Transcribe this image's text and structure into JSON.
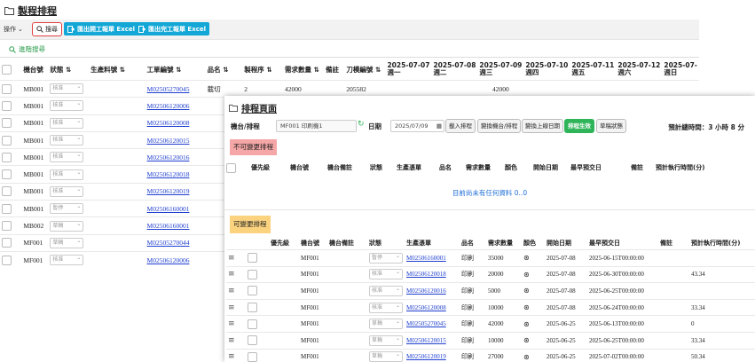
{
  "bg": {
    "title": "製程排程",
    "op_label": "操作",
    "search_label": "搜尋",
    "export1": "匯出開工報單 Excel",
    "export2": "匯出完工報單 Excel",
    "adv_search": "進階搜尋",
    "columns": {
      "machine": "機台號",
      "status": "狀態",
      "material": "生產料號",
      "order": "工單編號",
      "name": "品名",
      "seq": "製程序",
      "qty": "需求數量",
      "note": "備註",
      "blade": "刀模編號"
    },
    "dates": [
      {
        "date": "2025-07-07",
        "day": "週一"
      },
      {
        "date": "2025-07-08",
        "day": "週二"
      },
      {
        "date": "2025-07-09",
        "day": "週三"
      },
      {
        "date": "2025-07-10",
        "day": "週四"
      },
      {
        "date": "2025-07-11",
        "day": "週五"
      },
      {
        "date": "2025-07-12",
        "day": "週六"
      },
      {
        "date": "2025-07-",
        "day": "週日"
      }
    ],
    "rows": [
      {
        "machine": "MB001",
        "status": "核准",
        "order": "M02505270045",
        "name": "截切",
        "seq": "2",
        "qty": "42000",
        "blade": "205582",
        "d3": "42000"
      },
      {
        "machine": "MB001",
        "status": "核准",
        "order": "M02506120006"
      },
      {
        "machine": "MB001",
        "status": "核准",
        "order": "M02506120008"
      },
      {
        "machine": "MB001",
        "status": "核准",
        "order": "M02506120015"
      },
      {
        "machine": "MB001",
        "status": "核准",
        "order": "M02506120016"
      },
      {
        "machine": "MB001",
        "status": "核准",
        "order": "M02506120018"
      },
      {
        "machine": "MB001",
        "status": "核准",
        "order": "M02506120019"
      },
      {
        "machine": "MB001",
        "status": "暫停",
        "order": "M02506160001"
      },
      {
        "machine": "MB002",
        "status": "草稿",
        "order": "M02506160001"
      },
      {
        "machine": "MF001",
        "status": "草稿",
        "order": "M02505270044"
      },
      {
        "machine": "MF001",
        "status": "核准",
        "order": "M02506120006"
      }
    ]
  },
  "dlg": {
    "title": "排程頁面",
    "machine_label": "機台/排程",
    "machine_value": "MF001 印刷機1",
    "date_label": "日期",
    "date_value": "2025/07/09",
    "btn_import": "載入排程",
    "btn_switch": "變換機台/排程",
    "btn_online": "變換上線日期",
    "btn_generate": "排程生效",
    "btn_draft": "草稿狀態",
    "total": "預計總時間：3 小時 8 分",
    "locked_title": "不可變更排程",
    "unlocked_title": "可變更排程",
    "empty_msg": "目前尚未有任何資料 0..0",
    "cols_top": [
      "優先級",
      "機台號",
      "機台備註",
      "狀態",
      "生產憑單",
      "品名",
      "需求數量",
      "顏色",
      "開始日期",
      "最早預交日",
      "備註",
      "預計執行時間(分)"
    ],
    "cols_bottom": [
      "優先級",
      "機台號",
      "機台備註",
      "狀態",
      "生產憑單",
      "品名",
      "需求數量",
      "顏色",
      "開始日期",
      "最早預交日",
      "備註",
      "預計執行時間(分)"
    ],
    "rows": [
      {
        "machine": "MF001",
        "status": "暫停",
        "order": "M02506160001",
        "name": "印刷",
        "qty": "35000",
        "start": "2025-07-08",
        "due": "2025-06-15T00:00:00",
        "time": ""
      },
      {
        "machine": "MF001",
        "status": "核准",
        "order": "M02506120018",
        "name": "印刷",
        "qty": "20000",
        "start": "2025-07-08",
        "due": "2025-06-30T00:00:00",
        "time": "43.34"
      },
      {
        "machine": "MF001",
        "status": "核准",
        "order": "M02506120016",
        "name": "印刷",
        "qty": "5000",
        "start": "2025-07-08",
        "due": "2025-06-25T00:00:00",
        "time": ""
      },
      {
        "machine": "MF001",
        "status": "核准",
        "order": "M02506120008",
        "name": "印刷",
        "qty": "10000",
        "start": "2025-07-08",
        "due": "2025-06-24T00:00:00",
        "time": "33.34"
      },
      {
        "machine": "MF001",
        "status": "草稿",
        "order": "M02505270045",
        "name": "印刷",
        "qty": "42000",
        "start": "2025-06-25",
        "due": "2025-06-13T00:00:00",
        "time": "0"
      },
      {
        "machine": "MF001",
        "status": "草稿",
        "order": "M02506120015",
        "name": "印刷",
        "qty": "10000",
        "start": "2025-06-25",
        "due": "2025-06-25T00:00:00",
        "time": "33.34"
      },
      {
        "machine": "MF001",
        "status": "草稿",
        "order": "M02506120019",
        "name": "印刷",
        "qty": "27000",
        "start": "2025-06-25",
        "due": "2025-07-02T00:00:00",
        "time": "50.34"
      }
    ]
  }
}
